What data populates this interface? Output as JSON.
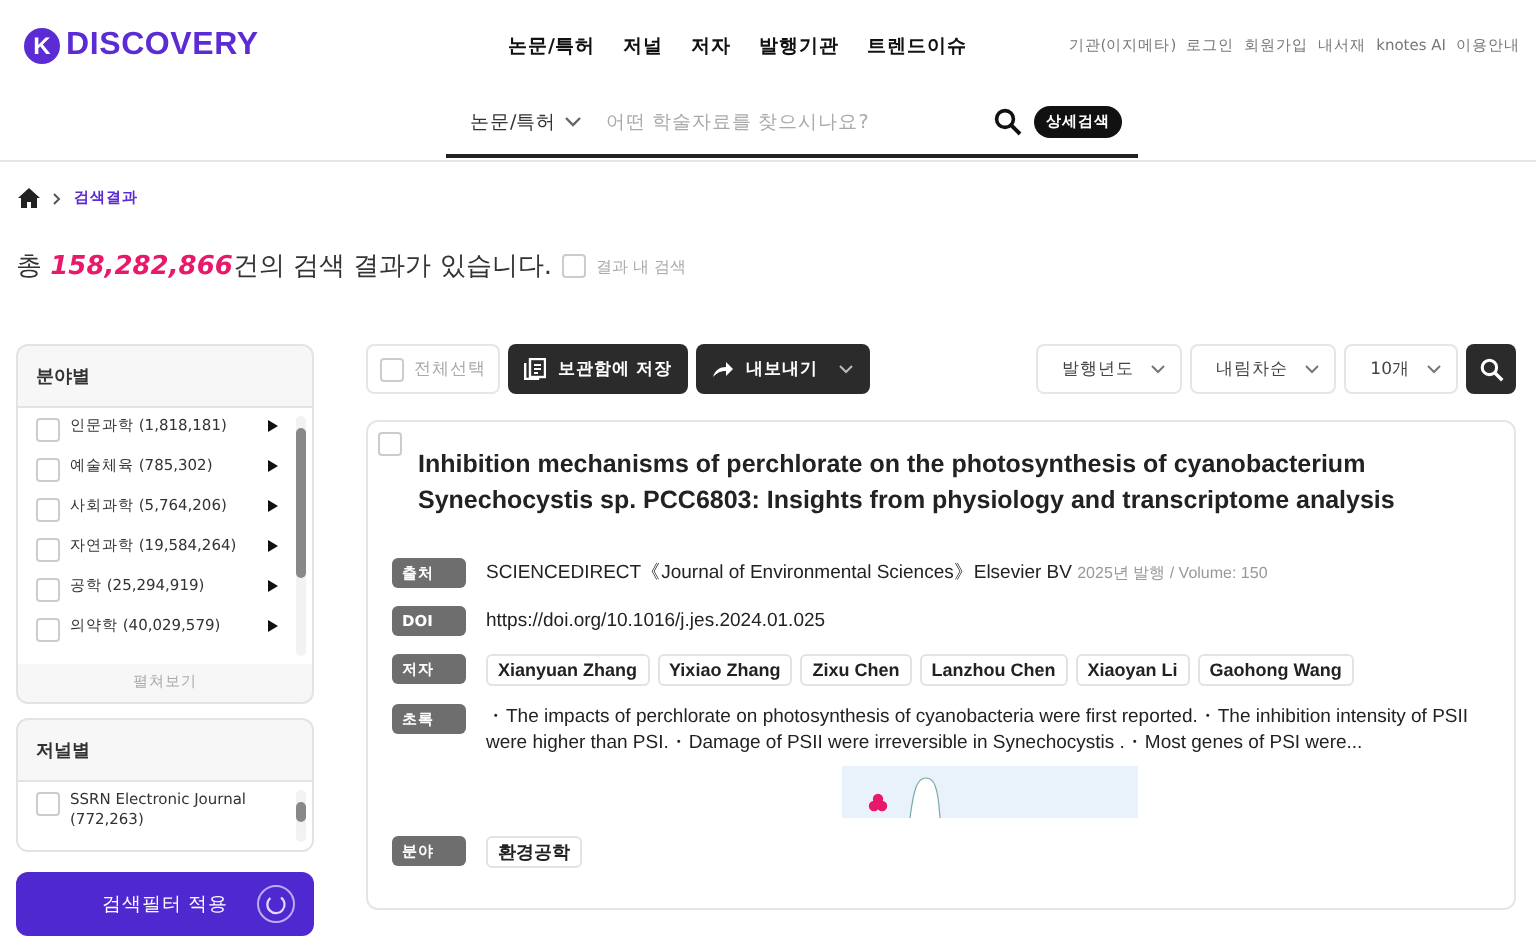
{
  "header": {
    "logo": {
      "letter": "K",
      "text": "DISCOVERY"
    },
    "nav": [
      "논문/특허",
      "저널",
      "저자",
      "발행기관",
      "트렌드이슈"
    ],
    "utility_links": [
      "기관(이지메타)",
      "로그인",
      "회원가입",
      "내서재",
      "knotes AI",
      "이용안내"
    ]
  },
  "search": {
    "category": "논문/특허",
    "placeholder": "어떤 학술자료를 찾으시나요?",
    "advanced_button": "상세검색"
  },
  "breadcrumb": {
    "current": "검색결과"
  },
  "summary": {
    "prefix": "총 ",
    "count": "158,282,866",
    "suffix": "건의 검색 결과가 있습니다.",
    "within_results": {
      "label": "결과 내 검색",
      "checked": false
    }
  },
  "sidebar": {
    "panels": [
      {
        "title": "분야별",
        "footer": "펼쳐보기",
        "items": [
          {
            "label": "인문과학 (1,818,181)",
            "checked": false
          },
          {
            "label": "예술체육 (785,302)",
            "checked": false
          },
          {
            "label": "사회과학 (5,764,206)",
            "checked": false
          },
          {
            "label": "자연과학 (19,584,264)",
            "checked": false
          },
          {
            "label": "공학 (25,294,919)",
            "checked": false
          },
          {
            "label": "의약학 (40,029,579)",
            "checked": false
          }
        ]
      },
      {
        "title": "저널별",
        "items": [
          {
            "label": "SSRN Electronic Journal (772,263)",
            "checked": false
          }
        ]
      }
    ],
    "apply_button": "검색필터 적용"
  },
  "toolbar": {
    "select_all": {
      "label": "전체선택",
      "checked": false
    },
    "save_button": "보관함에 저장",
    "export_button": "내보내기",
    "sort_options": [
      "발행년도",
      "내림차순",
      "10개"
    ]
  },
  "results": [
    {
      "checked": false,
      "title": "Inhibition mechanisms of perchlorate on the photosynthesis of cyanobacterium Synechocystis sp. PCC6803: Insights from physiology and transcriptome analysis",
      "fields": [
        {
          "label": "출처",
          "kind": "source",
          "text": "SCIENCEDIRECT《Journal of Environmental Sciences》Elsevier BV",
          "meta": "2025년 발행 / Volume: 150"
        },
        {
          "label": "DOI",
          "kind": "text",
          "text": "https://doi.org/10.1016/j.jes.2024.01.025"
        },
        {
          "label": "저자",
          "kind": "tags",
          "tags": [
            "Xianyuan Zhang",
            "Yixiao Zhang",
            "Zixu Chen",
            "Lanzhou Chen",
            "Xiaoyan Li",
            "Gaohong Wang"
          ]
        },
        {
          "label": "초록",
          "kind": "abstract",
          "text": "・The impacts of perchlorate on photosynthesis of cyanobacteria were first reported.・The inhibition intensity of PSII were higher than PSI.・Damage of PSII were irreversible in Synechocystis .・Most genes of PSI were..."
        },
        {
          "label": "분야",
          "kind": "tags",
          "tags": [
            "환경공학"
          ]
        }
      ]
    }
  ]
}
